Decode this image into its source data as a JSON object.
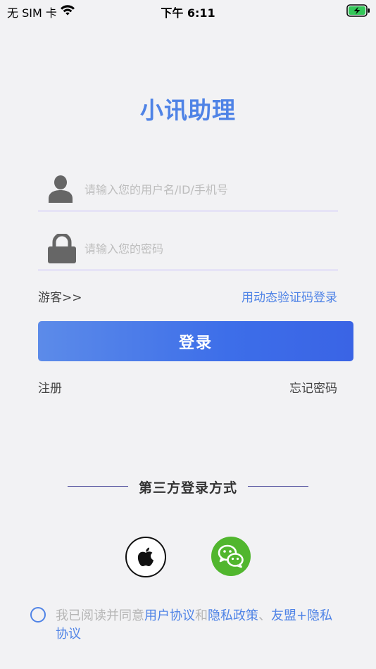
{
  "status_bar": {
    "carrier": "无 SIM 卡",
    "time": "下午 6:11"
  },
  "app": {
    "title": "小讯助理"
  },
  "login_form": {
    "username_placeholder": "请输入您的用户名/ID/手机号",
    "username_value": "",
    "password_placeholder": "请输入您的密码",
    "password_value": "",
    "guest_label": "游客>>",
    "sms_login_label": "用动态验证码登录",
    "login_button_label": "登录",
    "register_label": "注册",
    "forgot_password_label": "忘记密码"
  },
  "third_party": {
    "title": "第三方登录方式",
    "providers": [
      "apple-icon",
      "wechat-icon"
    ]
  },
  "agreement": {
    "prefix": "我已阅读并同意",
    "user_agreement": "用户协议",
    "and": "和",
    "privacy_policy": "隐私政策",
    "separator": "、",
    "union_privacy": "友盟+隐私协议"
  },
  "colors": {
    "accent": "#4f83e6",
    "button_gradient_start": "#5c8be9",
    "button_gradient_end": "#3a64e5",
    "wechat_green": "#51b62e",
    "battery_green": "#34c759",
    "divider": "#3f3d93",
    "background": "#f2f2f4"
  }
}
